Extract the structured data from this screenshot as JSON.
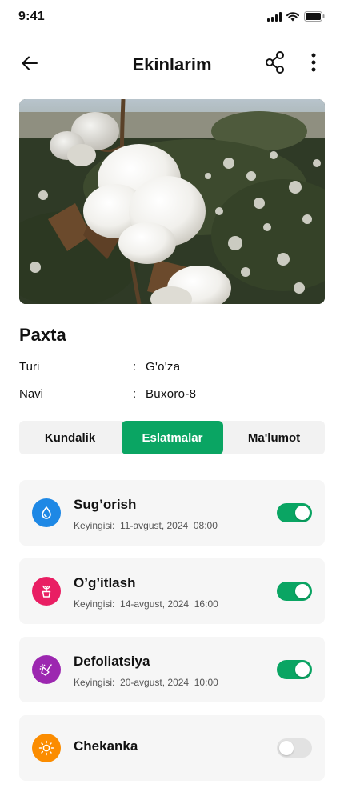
{
  "status_bar": {
    "time": "9:41",
    "icons": [
      "signal-icon",
      "wifi-icon",
      "battery-icon"
    ]
  },
  "header": {
    "title": "Ekinlarim",
    "back_icon": "arrow-left-icon",
    "share_icon": "share-icon",
    "more_icon": "more-vertical-icon"
  },
  "crop": {
    "name": "Paxta",
    "details": [
      {
        "label": "Turi",
        "value": "G'o'za"
      },
      {
        "label": "Navi",
        "value": "Buxoro-8"
      }
    ]
  },
  "tabs": [
    {
      "label": "Kundalik",
      "active": false
    },
    {
      "label": "Eslatmalar",
      "active": true
    },
    {
      "label": "Ma'lumot",
      "active": false
    }
  ],
  "reminders": [
    {
      "title": "Sug’orish",
      "subtitle": "Keyingisi:  11-avgust, 2024  08:00",
      "enabled": true,
      "icon": "water-drop-icon",
      "icon_color": "#1e88e5"
    },
    {
      "title": "O’g’itlash",
      "subtitle": "Keyingisi:  14-avgust, 2024  16:00",
      "enabled": true,
      "icon": "plant-pot-icon",
      "icon_color": "#e91e63"
    },
    {
      "title": "Defoliatsiya",
      "subtitle": "Keyingisi:  20-avgust, 2024  10:00",
      "enabled": true,
      "icon": "sprayer-icon",
      "icon_color": "#9c27b0"
    },
    {
      "title": "Chekanka",
      "subtitle": "",
      "enabled": false,
      "icon": "sun-icon",
      "icon_color": "#fb8c00"
    }
  ],
  "colors": {
    "accent": "#0aa563",
    "toggle_off": "#e2e2e2"
  }
}
